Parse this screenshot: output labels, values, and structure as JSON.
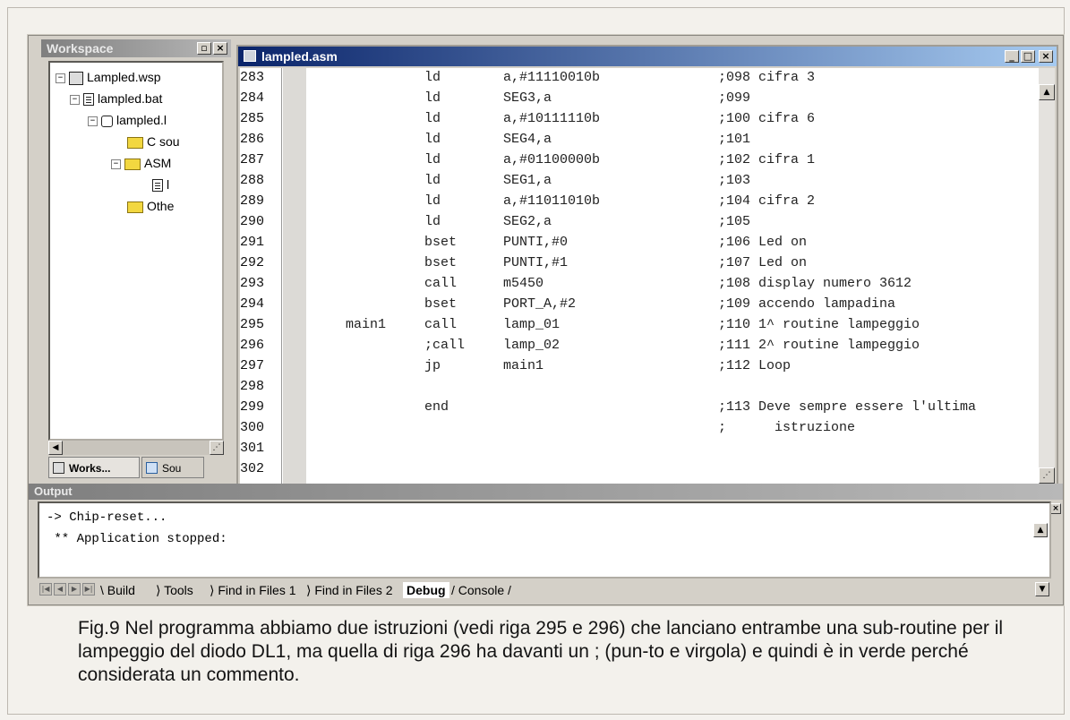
{
  "workspace": {
    "title": "Workspace",
    "tree": [
      {
        "label": "Lampled.wsp"
      },
      {
        "label": "lampled.bat"
      },
      {
        "label": "lampled.l"
      },
      {
        "label": "C sou"
      },
      {
        "label": "ASM"
      },
      {
        "label": "l"
      },
      {
        "label": "Othe"
      }
    ],
    "tabs": [
      "Works...",
      "Sou"
    ]
  },
  "editor": {
    "title": "lampled.asm",
    "lines": [
      {
        "num": "283",
        "label": "",
        "op": "ld",
        "arg": "a,#11110010b",
        "comment": ";098 cifra 3"
      },
      {
        "num": "284",
        "label": "",
        "op": "ld",
        "arg": "SEG3,a",
        "comment": ";099"
      },
      {
        "num": "285",
        "label": "",
        "op": "ld",
        "arg": "a,#10111110b",
        "comment": ";100 cifra 6"
      },
      {
        "num": "286",
        "label": "",
        "op": "ld",
        "arg": "SEG4,a",
        "comment": ";101"
      },
      {
        "num": "287",
        "label": "",
        "op": "ld",
        "arg": "a,#01100000b",
        "comment": ";102 cifra 1"
      },
      {
        "num": "288",
        "label": "",
        "op": "ld",
        "arg": "SEG1,a",
        "comment": ";103"
      },
      {
        "num": "289",
        "label": "",
        "op": "ld",
        "arg": "a,#11011010b",
        "comment": ";104 cifra 2"
      },
      {
        "num": "290",
        "label": "",
        "op": "ld",
        "arg": "SEG2,a",
        "comment": ";105"
      },
      {
        "num": "291",
        "label": "",
        "op": "bset",
        "arg": "PUNTI,#0",
        "comment": ";106 Led on"
      },
      {
        "num": "292",
        "label": "",
        "op": "bset",
        "arg": "PUNTI,#1",
        "comment": ";107 Led on"
      },
      {
        "num": "293",
        "label": "",
        "op": "call",
        "arg": "m5450",
        "comment": ";108 display numero 3612"
      },
      {
        "num": "294",
        "label": "",
        "op": "bset",
        "arg": "PORT_A,#2",
        "comment": ";109 accendo lampadina"
      },
      {
        "num": "295",
        "label": "main1",
        "op": "call",
        "arg": "lamp_01",
        "comment": ";110 1^ routine lampeggio"
      },
      {
        "num": "296",
        "label": "",
        "op": ";call",
        "arg": "lamp_02",
        "comment": ";111 2^ routine lampeggio"
      },
      {
        "num": "297",
        "label": "",
        "op": "jp",
        "arg": "main1",
        "comment": ";112 Loop"
      },
      {
        "num": "298",
        "label": "",
        "op": "",
        "arg": "",
        "comment": ""
      },
      {
        "num": "299",
        "label": "",
        "op": "end",
        "arg": "",
        "comment": ";113 Deve sempre essere l'ultima"
      },
      {
        "num": "300",
        "label": "",
        "op": "",
        "arg": "",
        "comment": ";      istruzione"
      },
      {
        "num": "301",
        "label": "",
        "op": "",
        "arg": "",
        "comment": ""
      },
      {
        "num": "302",
        "label": "",
        "op": "",
        "arg": "",
        "comment": ""
      }
    ]
  },
  "output": {
    "title": "Output",
    "lines": [
      "-> Chip-reset...",
      " ** Application stopped:"
    ],
    "tabs": [
      "Build",
      "Tools",
      "Find in Files 1",
      "Find in Files 2",
      "Debug",
      "Console"
    ],
    "active_tab": "Debug"
  },
  "caption": "Fig.9 Nel programma abbiamo due istruzioni (vedi riga 295 e 296) che lanciano entrambe una sub-routine per il lampeggio del diodo DL1, ma quella di riga 296 ha davanti un ; (pun-to e virgola) e quindi è in verde perché considerata un commento.",
  "colors": {
    "active_title": "#0a246a",
    "inactive_title": "#808080",
    "folder": "#f2d740"
  }
}
